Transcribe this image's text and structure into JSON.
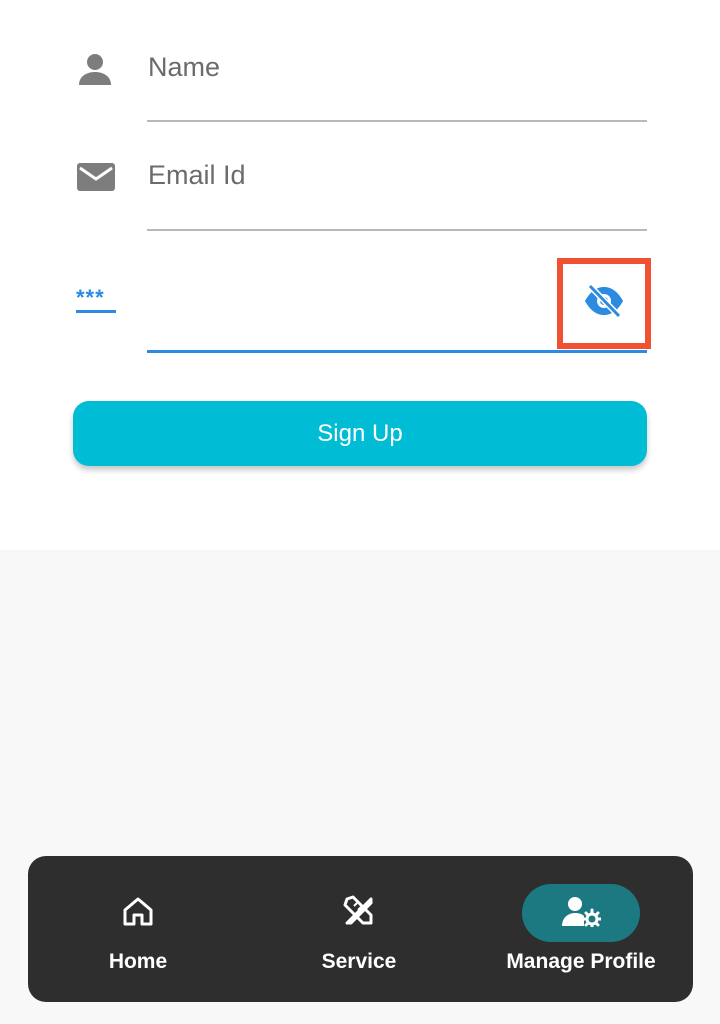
{
  "form": {
    "name_placeholder": "Name",
    "email_placeholder": "Email Id",
    "password_mask_icon_text": "***",
    "password_value": "",
    "signup_label": "Sign Up"
  },
  "bottom_nav": {
    "items": [
      {
        "label": "Home",
        "icon": "home-icon",
        "active": false
      },
      {
        "label": "Service",
        "icon": "service-tools-icon",
        "active": false
      },
      {
        "label": "Manage Profile",
        "icon": "user-settings-icon",
        "active": true
      }
    ]
  },
  "colors": {
    "accent": "#00bcd4",
    "focus_blue": "#2b8be0",
    "highlight_box": "#f05133",
    "nav_bg": "#2e2e2e",
    "nav_active_pill": "#1c7981"
  }
}
